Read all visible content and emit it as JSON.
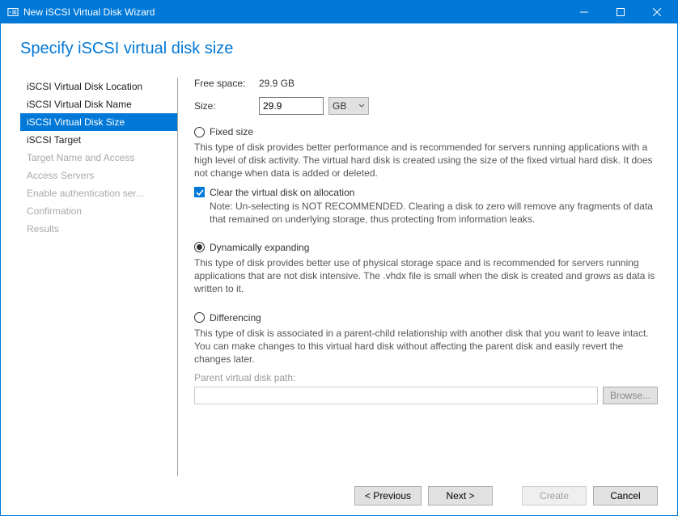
{
  "window": {
    "title": "New iSCSI Virtual Disk Wizard"
  },
  "page_title": "Specify iSCSI virtual disk size",
  "sidebar": {
    "items": [
      {
        "label": "iSCSI Virtual Disk Location",
        "state": "enabled"
      },
      {
        "label": "iSCSI Virtual Disk Name",
        "state": "enabled"
      },
      {
        "label": "iSCSI Virtual Disk Size",
        "state": "active"
      },
      {
        "label": "iSCSI Target",
        "state": "enabled"
      },
      {
        "label": "Target Name and Access",
        "state": "disabled"
      },
      {
        "label": "Access Servers",
        "state": "disabled"
      },
      {
        "label": "Enable authentication ser...",
        "state": "disabled"
      },
      {
        "label": "Confirmation",
        "state": "disabled"
      },
      {
        "label": "Results",
        "state": "disabled"
      }
    ]
  },
  "free_space": {
    "label": "Free space:",
    "value": "29.9 GB"
  },
  "size": {
    "label": "Size:",
    "value": "29.9",
    "unit": "GB"
  },
  "options": {
    "fixed": {
      "label": "Fixed size",
      "desc": "This type of disk provides better performance and is recommended for servers running applications with a high level of disk activity. The virtual hard disk is created using the size of the fixed virtual hard disk. It does not change when data is added or deleted.",
      "clear_label": "Clear the virtual disk on allocation",
      "clear_checked": true,
      "clear_note": "Note: Un-selecting is NOT RECOMMENDED. Clearing a disk to zero will remove any fragments of data that remained on underlying storage, thus protecting from information leaks."
    },
    "dynamic": {
      "label": "Dynamically expanding",
      "selected": true,
      "desc": "This type of disk provides better use of physical storage space and is recommended for servers running applications that are not disk intensive. The .vhdx file is small when the disk is created and grows as data is written to it."
    },
    "differencing": {
      "label": "Differencing",
      "desc": "This type of disk is associated in a parent-child relationship with another disk that you want to leave intact. You can make changes to this virtual hard disk without affecting the parent disk and easily revert the changes later.",
      "parent_path_label": "Parent virtual disk path:",
      "parent_path_value": "",
      "browse_label": "Browse..."
    }
  },
  "buttons": {
    "previous": "< Previous",
    "next": "Next >",
    "create": "Create",
    "cancel": "Cancel"
  }
}
